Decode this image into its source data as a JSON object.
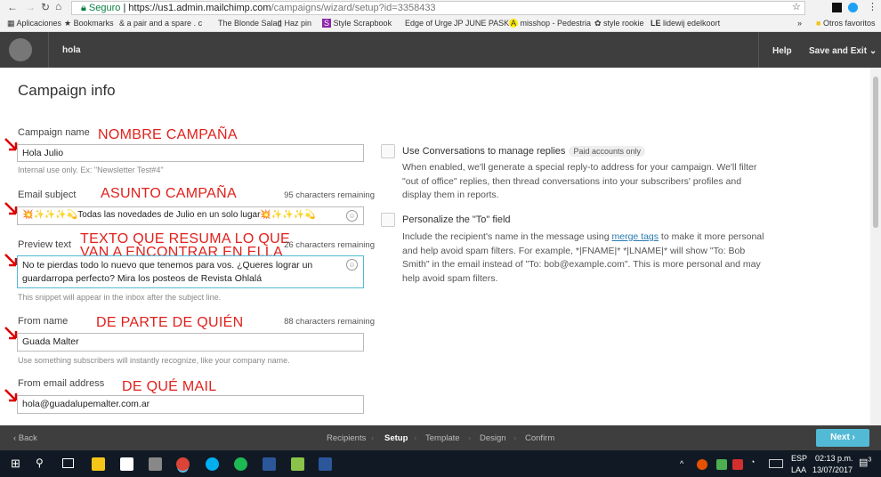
{
  "browser": {
    "secure": "Seguro",
    "url_host": "https://us1.admin.mailchimp.com",
    "url_path": "/campaigns/wizard/setup?id=3358433",
    "bookmarks": [
      "Aplicaciones",
      "Bookmarks",
      "a pair and a spare . c",
      "The Blonde Salad",
      "Haz pin",
      "Style Scrapbook",
      "Edge of Urge",
      "JUNE PASKI",
      "misshop - Pedestria",
      "style rookie",
      "lidewij edelkoort"
    ],
    "more": "»",
    "other": "Otros favoritos"
  },
  "header": {
    "campaign": "hola",
    "help": "Help",
    "save_exit": "Save and Exit"
  },
  "main": {
    "title": "Campaign info",
    "campaign_name": {
      "label": "Campaign name",
      "value": "Hola Julio",
      "help": "Internal use only. Ex: \"Newsletter Test#4\""
    },
    "email_subject": {
      "label": "Email subject",
      "remaining": "95 characters remaining",
      "value": "💥✨✨✨💫Todas las novedades de Julio en un solo lugar💥✨✨✨💫"
    },
    "preview_text": {
      "label": "Preview text",
      "remaining": "26 characters remaining",
      "value": "No te pierdas todo lo nuevo que tenemos para vos. ¿Queres lograr un guardarropa perfecto? Mira los posteos de Revista Ohlalá",
      "help": "This snippet will appear in the inbox after the subject line."
    },
    "from_name": {
      "label": "From name",
      "remaining": "88 characters remaining",
      "value": "Guada Malter",
      "help": "Use something subscribers will instantly recognize, like your company name."
    },
    "from_email": {
      "label": "From email address",
      "value": "hola@guadalupemalter.com.ar"
    },
    "conversations": {
      "label": "Use Conversations to manage replies",
      "badge": "Paid accounts only",
      "desc": "When enabled, we'll generate a special reply-to address for your campaign. We'll filter \"out of office\" replies, then thread conversations into your subscribers' profiles and display them in reports.",
      "checked": false
    },
    "personalize": {
      "label": "Personalize the \"To\" field",
      "desc_a": "Include the recipient's name in the message using ",
      "link": "merge tags",
      "desc_b": " to make it more personal and help avoid spam filters. For example, *|FNAME|* *|LNAME|* will show \"To: Bob Smith\" in the email instead of \"To: bob@example.com\". This is more personal and may help avoid spam filters.",
      "checked": false
    }
  },
  "annotations": {
    "name": "NOMBRE CAMPAÑA",
    "subject": "ASUNTO CAMPAÑA",
    "preview1": "TEXTO QUE RESUMA LO QUE",
    "preview2": "VAN A ENCONTRAR EN ELLA",
    "from": "DE PARTE DE QUIÉN",
    "email": "DE QUÉ MAIL",
    "color": "#e0211c"
  },
  "footer": {
    "back": "‹ Back",
    "steps": [
      "Recipients",
      "Setup",
      "Template",
      "Design",
      "Confirm"
    ],
    "active": "Setup",
    "next": "Next ›"
  },
  "taskbar": {
    "lang1": "ESP",
    "lang2": "LAA",
    "time": "02:13 p.m.",
    "date": "13/07/2017",
    "notifications": "3"
  }
}
